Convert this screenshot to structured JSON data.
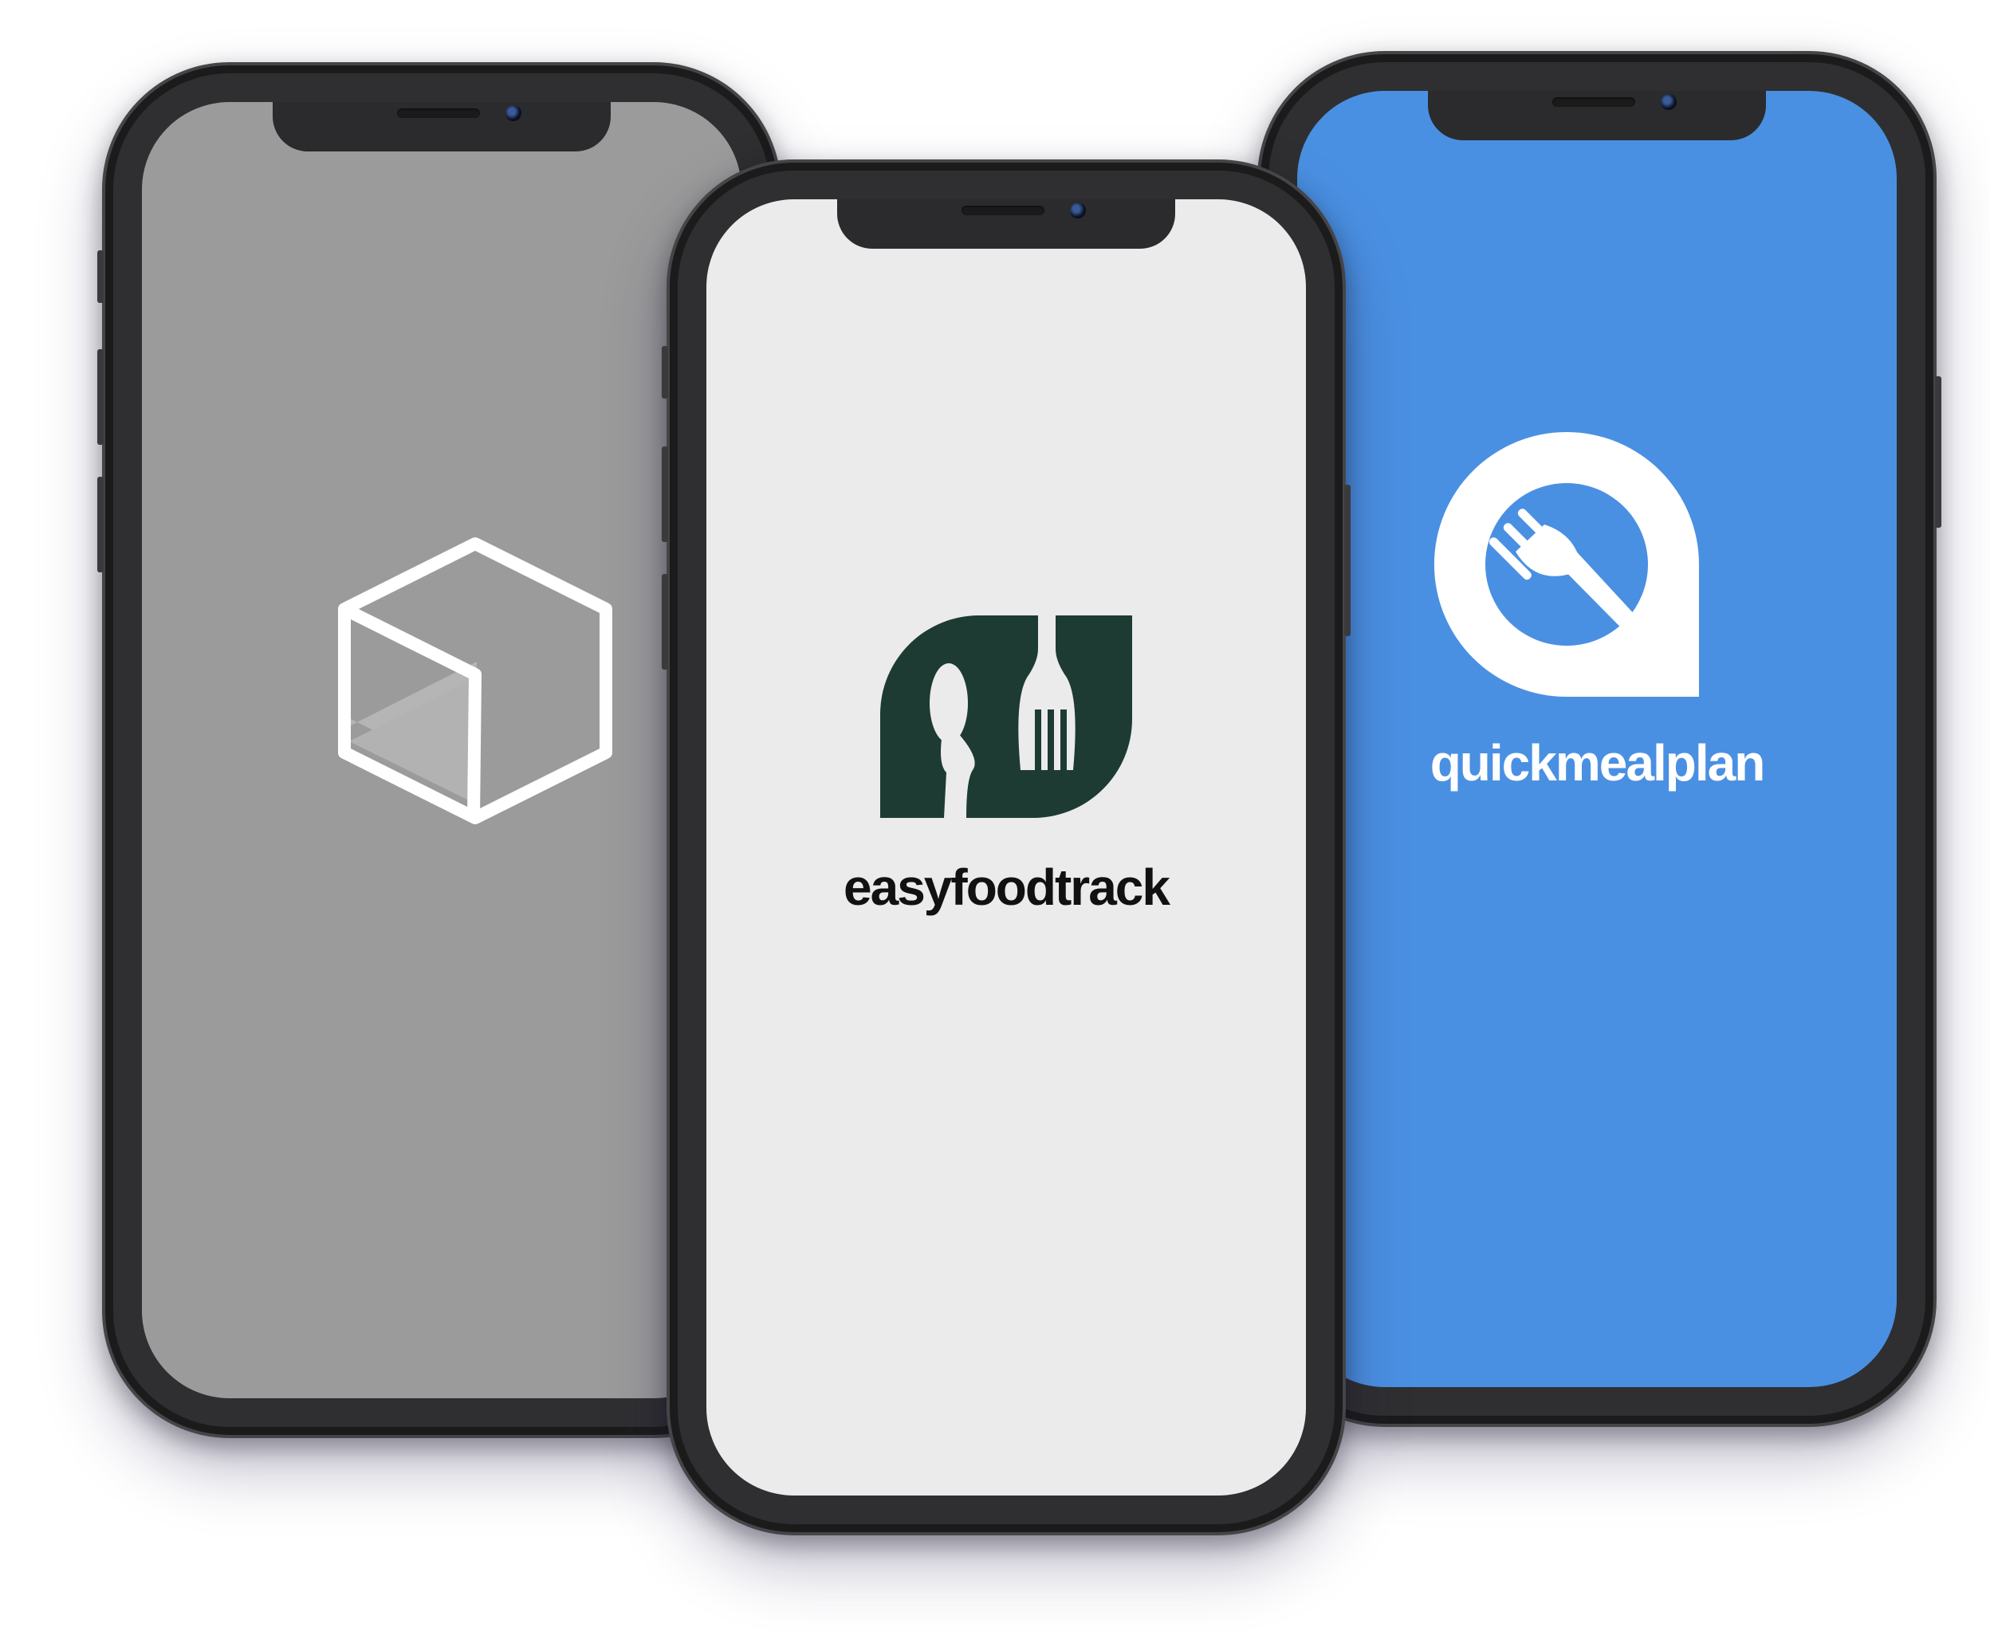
{
  "phones": [
    {
      "position": "left",
      "screen_color": "#9b9b9b",
      "icon": "cube-icon",
      "app_name": ""
    },
    {
      "position": "center",
      "screen_color": "#ebebec",
      "icon": "spoon-fork-logo-icon",
      "logo_color": "#1d3b33",
      "app_name": "easyfoodtrack"
    },
    {
      "position": "right",
      "screen_color": "#4a90e2",
      "icon": "q-fork-logo-icon",
      "logo_color": "#ffffff",
      "app_name": "quickmealplan"
    }
  ]
}
